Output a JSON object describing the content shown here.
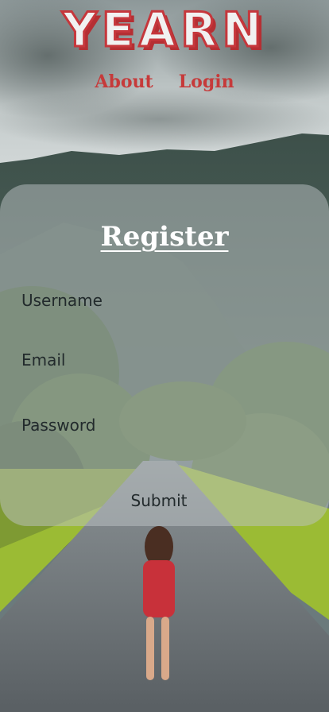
{
  "header": {
    "logo_text": "YEARN",
    "nav": [
      {
        "label": "About"
      },
      {
        "label": "Login"
      }
    ]
  },
  "register": {
    "title": "Register",
    "fields": [
      {
        "label": "Username"
      },
      {
        "label": "Email"
      },
      {
        "label": "Password"
      }
    ],
    "submit_label": "Submit"
  },
  "colors": {
    "brand_red": "#c6373c",
    "card_overlay": "rgba(190,196,197,0.50)"
  }
}
